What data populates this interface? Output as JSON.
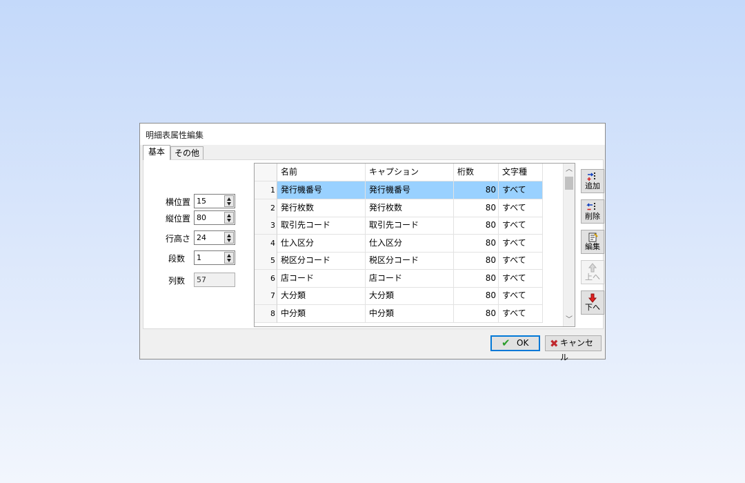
{
  "dialog": {
    "title": "明細表属性編集"
  },
  "tabs": [
    {
      "label": "基本"
    },
    {
      "label": "その他"
    }
  ],
  "fields": {
    "x_pos": {
      "label": "横位置",
      "value": "15"
    },
    "y_pos": {
      "label": "縦位置",
      "value": "80"
    },
    "row_height": {
      "label": "行高さ",
      "value": "24"
    },
    "tiers": {
      "label": "段数",
      "value": "1"
    },
    "columns": {
      "label": "列数",
      "value": "57"
    }
  },
  "grid": {
    "headers": [
      "名前",
      "キャプション",
      "桁数",
      "文字種"
    ],
    "rows": [
      {
        "no": "1",
        "name": "発行機番号",
        "caption": "発行機番号",
        "digits": "80",
        "type": "すべて"
      },
      {
        "no": "2",
        "name": "発行枚数",
        "caption": "発行枚数",
        "digits": "80",
        "type": "すべて"
      },
      {
        "no": "3",
        "name": "取引先コード",
        "caption": "取引先コード",
        "digits": "80",
        "type": "すべて"
      },
      {
        "no": "4",
        "name": "仕入区分",
        "caption": "仕入区分",
        "digits": "80",
        "type": "すべて"
      },
      {
        "no": "5",
        "name": "税区分コード",
        "caption": "税区分コード",
        "digits": "80",
        "type": "すべて"
      },
      {
        "no": "6",
        "name": "店コード",
        "caption": "店コード",
        "digits": "80",
        "type": "すべて"
      },
      {
        "no": "7",
        "name": "大分類",
        "caption": "大分類",
        "digits": "80",
        "type": "すべて"
      },
      {
        "no": "8",
        "name": "中分類",
        "caption": "中分類",
        "digits": "80",
        "type": "すべて"
      }
    ],
    "selected_row": 0,
    "selection_color": "#99d1ff"
  },
  "side_buttons": {
    "add": {
      "label": "追加",
      "icon": "add-row-icon"
    },
    "delete": {
      "label": "削除",
      "icon": "delete-row-icon"
    },
    "edit": {
      "label": "編集",
      "icon": "edit-icon"
    },
    "up": {
      "label": "上へ",
      "icon": "arrow-up-icon"
    },
    "down": {
      "label": "下へ",
      "icon": "arrow-down-icon"
    }
  },
  "footer": {
    "ok_label": "OK",
    "cancel_label": "キャンセル"
  },
  "colors": {
    "accent": "#0078d7",
    "ok_check": "#2a9d2a",
    "cancel_x": "#c0282e"
  }
}
